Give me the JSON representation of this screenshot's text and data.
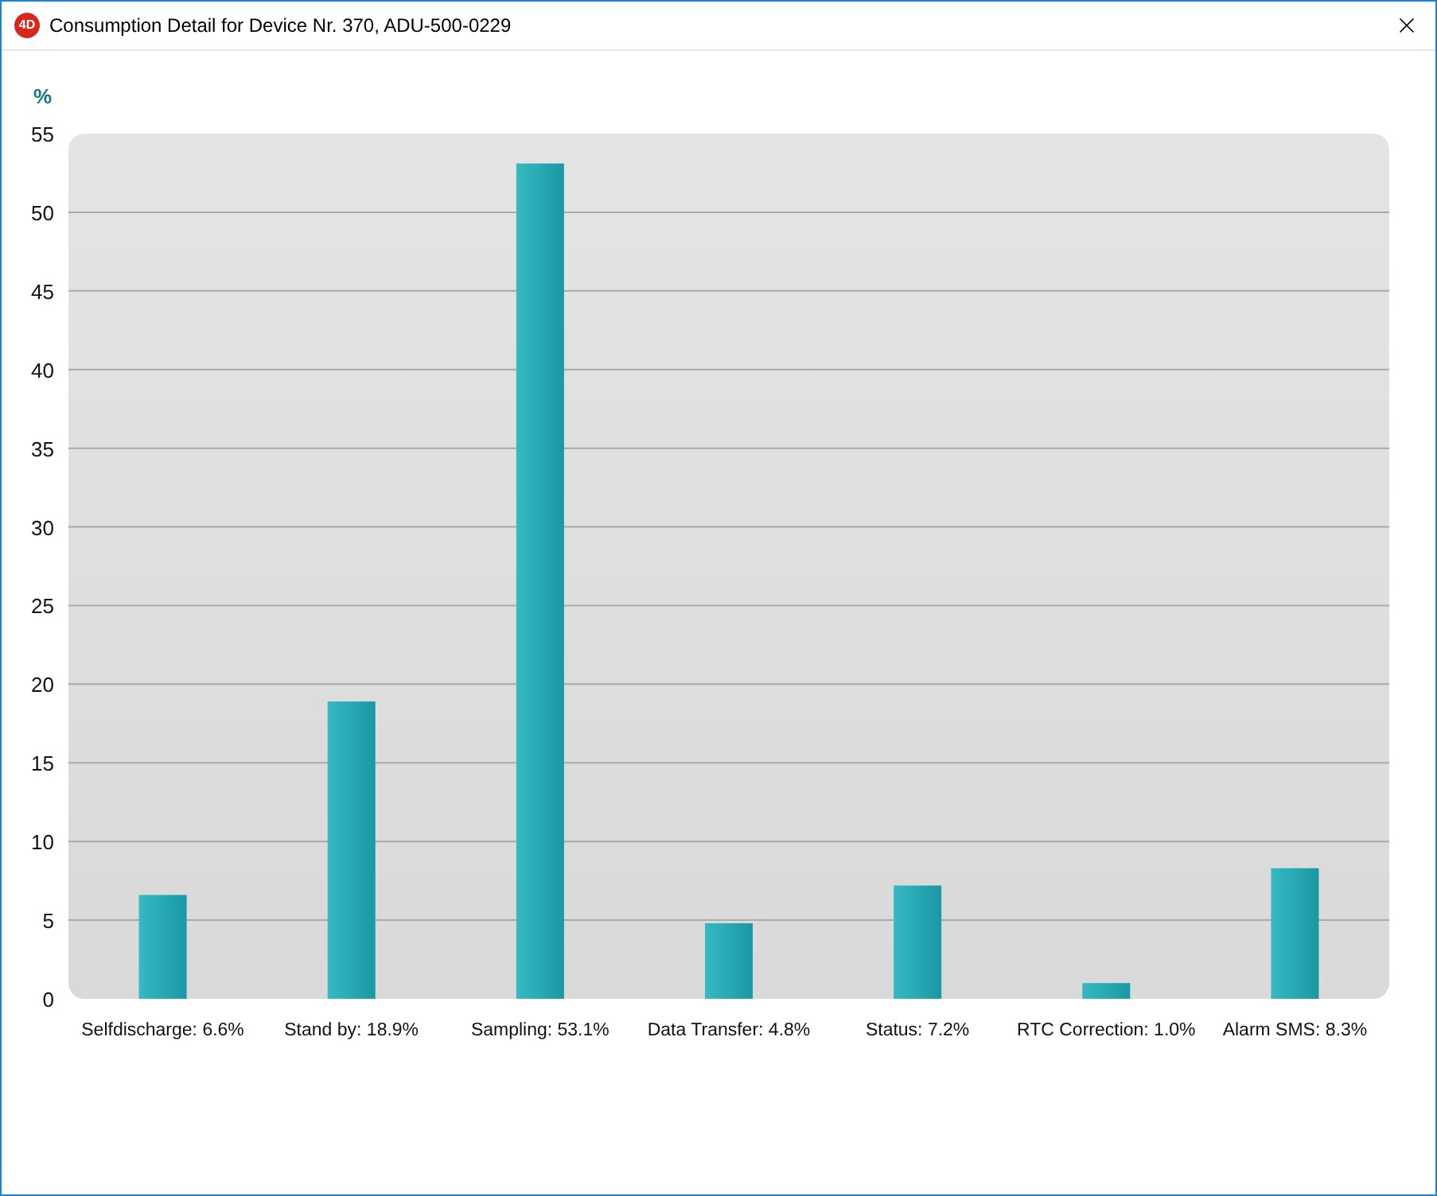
{
  "window": {
    "title": "Consumption Detail for Device Nr. 370, ADU-500-0229",
    "icon_label": "4D"
  },
  "chart": {
    "chart_data": {
      "type": "bar",
      "ylabel": "%",
      "categories": [
        "Selfdischarge: 6.6%",
        "Stand by: 18.9%",
        "Sampling: 53.1%",
        "Data Transfer: 4.8%",
        "Status: 7.2%",
        "RTC Correction: 1.0%",
        "Alarm SMS: 8.3%"
      ],
      "values": [
        6.6,
        18.9,
        53.1,
        4.8,
        7.2,
        1.0,
        8.3
      ],
      "ylim": [
        0,
        55
      ],
      "grid": true,
      "yticks": [
        0,
        5,
        10,
        15,
        20,
        25,
        30,
        35,
        40,
        45,
        50,
        55
      ]
    }
  }
}
